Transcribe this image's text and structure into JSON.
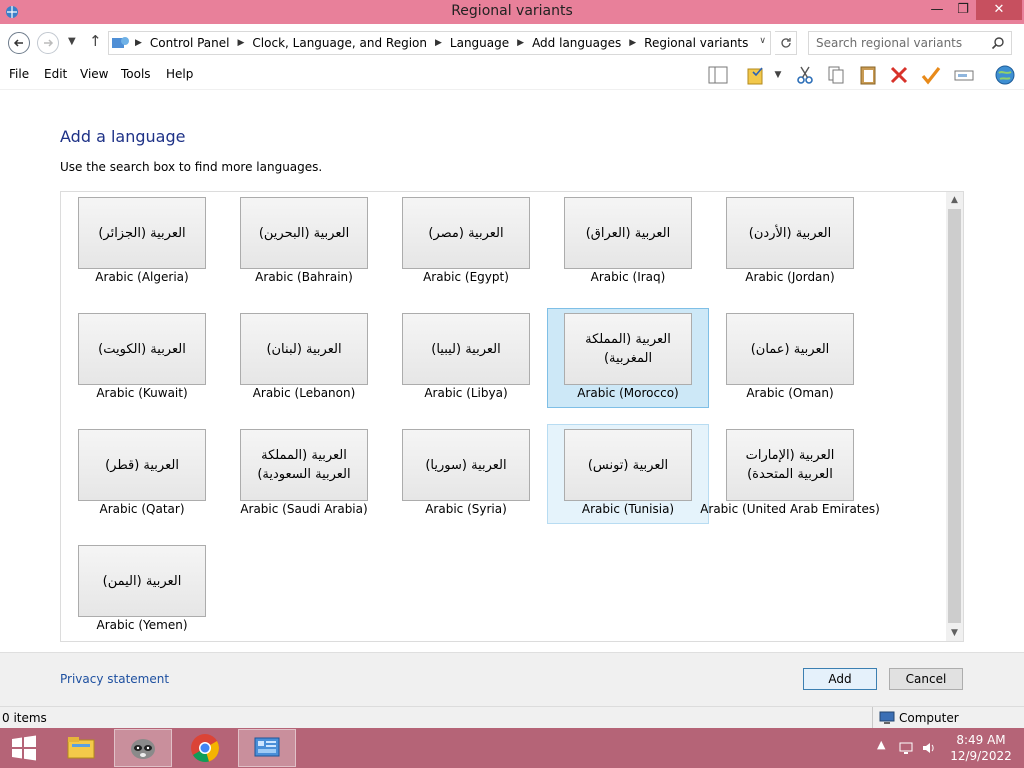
{
  "window": {
    "title": "Regional variants",
    "controls": {
      "minimize": "—",
      "maximize": "❐",
      "close": "✕"
    }
  },
  "address": {
    "breadcrumbs": [
      "Control Panel",
      "Clock, Language, and Region",
      "Language",
      "Add languages",
      "Regional variants"
    ],
    "search_placeholder": "Search regional variants"
  },
  "menu": {
    "items": [
      "File",
      "Edit",
      "View",
      "Tools",
      "Help"
    ]
  },
  "main": {
    "heading": "Add a language",
    "subtitle": "Use the search box to find more languages.",
    "languages": [
      {
        "native": "العربية (الجزائر)",
        "name": "Arabic (Algeria)"
      },
      {
        "native": "العربية (البحرين)",
        "name": "Arabic (Bahrain)"
      },
      {
        "native": "العربية (مصر)",
        "name": "Arabic (Egypt)"
      },
      {
        "native": "العربية (العراق)",
        "name": "Arabic (Iraq)"
      },
      {
        "native": "العربية (الأردن)",
        "name": "Arabic (Jordan)"
      },
      {
        "native": "العربية (الكويت)",
        "name": "Arabic (Kuwait)"
      },
      {
        "native": "العربية (لبنان)",
        "name": "Arabic (Lebanon)"
      },
      {
        "native": "العربية (ليبيا)",
        "name": "Arabic (Libya)"
      },
      {
        "native": "العربية (المملكة المغربية)",
        "name": "Arabic (Morocco)",
        "state": "selected"
      },
      {
        "native": "العربية (عمان)",
        "name": "Arabic (Oman)"
      },
      {
        "native": "العربية (قطر)",
        "name": "Arabic (Qatar)"
      },
      {
        "native": "العربية (المملكة العربية السعودية)",
        "name": "Arabic (Saudi Arabia)"
      },
      {
        "native": "العربية (سوريا)",
        "name": "Arabic (Syria)"
      },
      {
        "native": "العربية (تونس)",
        "name": "Arabic (Tunisia)",
        "state": "hover"
      },
      {
        "native": "العربية (الإمارات العربية المتحدة)",
        "name": "Arabic (United Arab Emirates)"
      },
      {
        "native": "العربية (اليمن)",
        "name": "Arabic (Yemen)"
      }
    ]
  },
  "footer": {
    "privacy_link": "Privacy statement",
    "add_label": "Add",
    "cancel_label": "Cancel"
  },
  "status_bar": {
    "items_count": "0 items",
    "zone": "Computer"
  },
  "taskbar": {
    "time": "8:49 AM",
    "date": "12/9/2022"
  },
  "colors": {
    "title_bar": "#e8809a",
    "taskbar": "#b56477",
    "heading": "#1e3287",
    "selected_tile": "#cde8f7"
  }
}
